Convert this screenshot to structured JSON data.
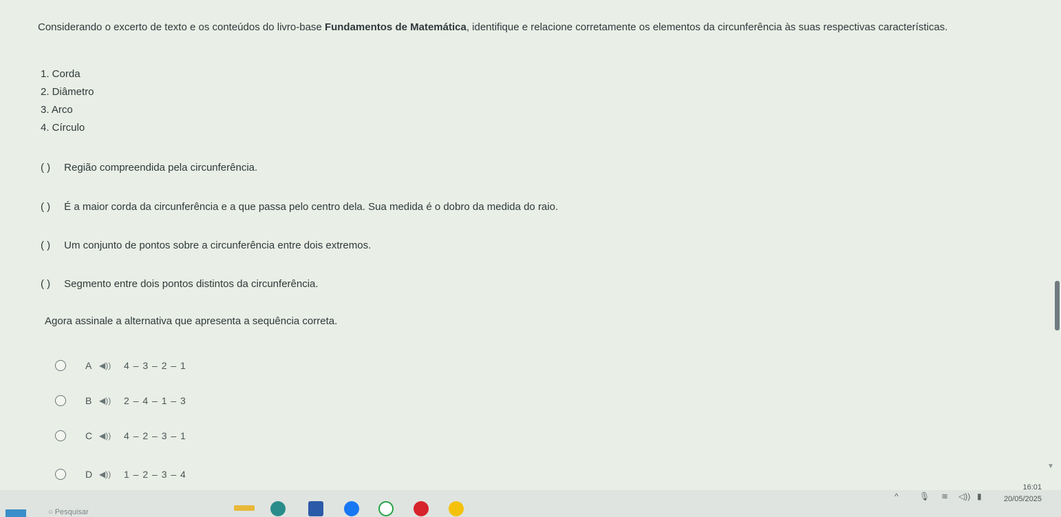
{
  "question": {
    "prefix": "Considerando o excerto de texto e os conteúdos do livro-base ",
    "book": "Fundamentos de Matemática",
    "suffix": ", identifique e relacione corretamente os elementos da circunferência às suas respectivas características."
  },
  "items": [
    "1. Corda",
    "2. Diâmetro",
    "3. Arco",
    "4. Círculo"
  ],
  "statements": [
    {
      "paren": "(      )",
      "text": "Região compreendida pela circunferência."
    },
    {
      "paren": "(      )",
      "text": "É a maior corda da circunferência e a que passa pelo centro dela. Sua medida é o dobro da medida do raio."
    },
    {
      "paren": "(      )",
      "text": "Um conjunto de pontos sobre a circunferência entre dois extremos."
    },
    {
      "paren": "(      )",
      "text": "Segmento entre dois pontos distintos da circunferência."
    }
  ],
  "instruction": "Agora assinale a alternativa que apresenta a sequência correta.",
  "options": [
    {
      "letter": "A",
      "sequence": "4 – 3 – 2 – 1"
    },
    {
      "letter": "B",
      "sequence": "2 – 4 – 1 – 3"
    },
    {
      "letter": "C",
      "sequence": "4 – 2 – 3 – 1"
    },
    {
      "letter": "D",
      "sequence": "1 – 2 – 3 – 4"
    }
  ],
  "taskbar": {
    "search_placeholder": "Pesquisar",
    "time": "16:01",
    "date": "20/05/2025"
  },
  "colors": {
    "accent": "#3a8ec9",
    "background": "#e9eee6"
  }
}
